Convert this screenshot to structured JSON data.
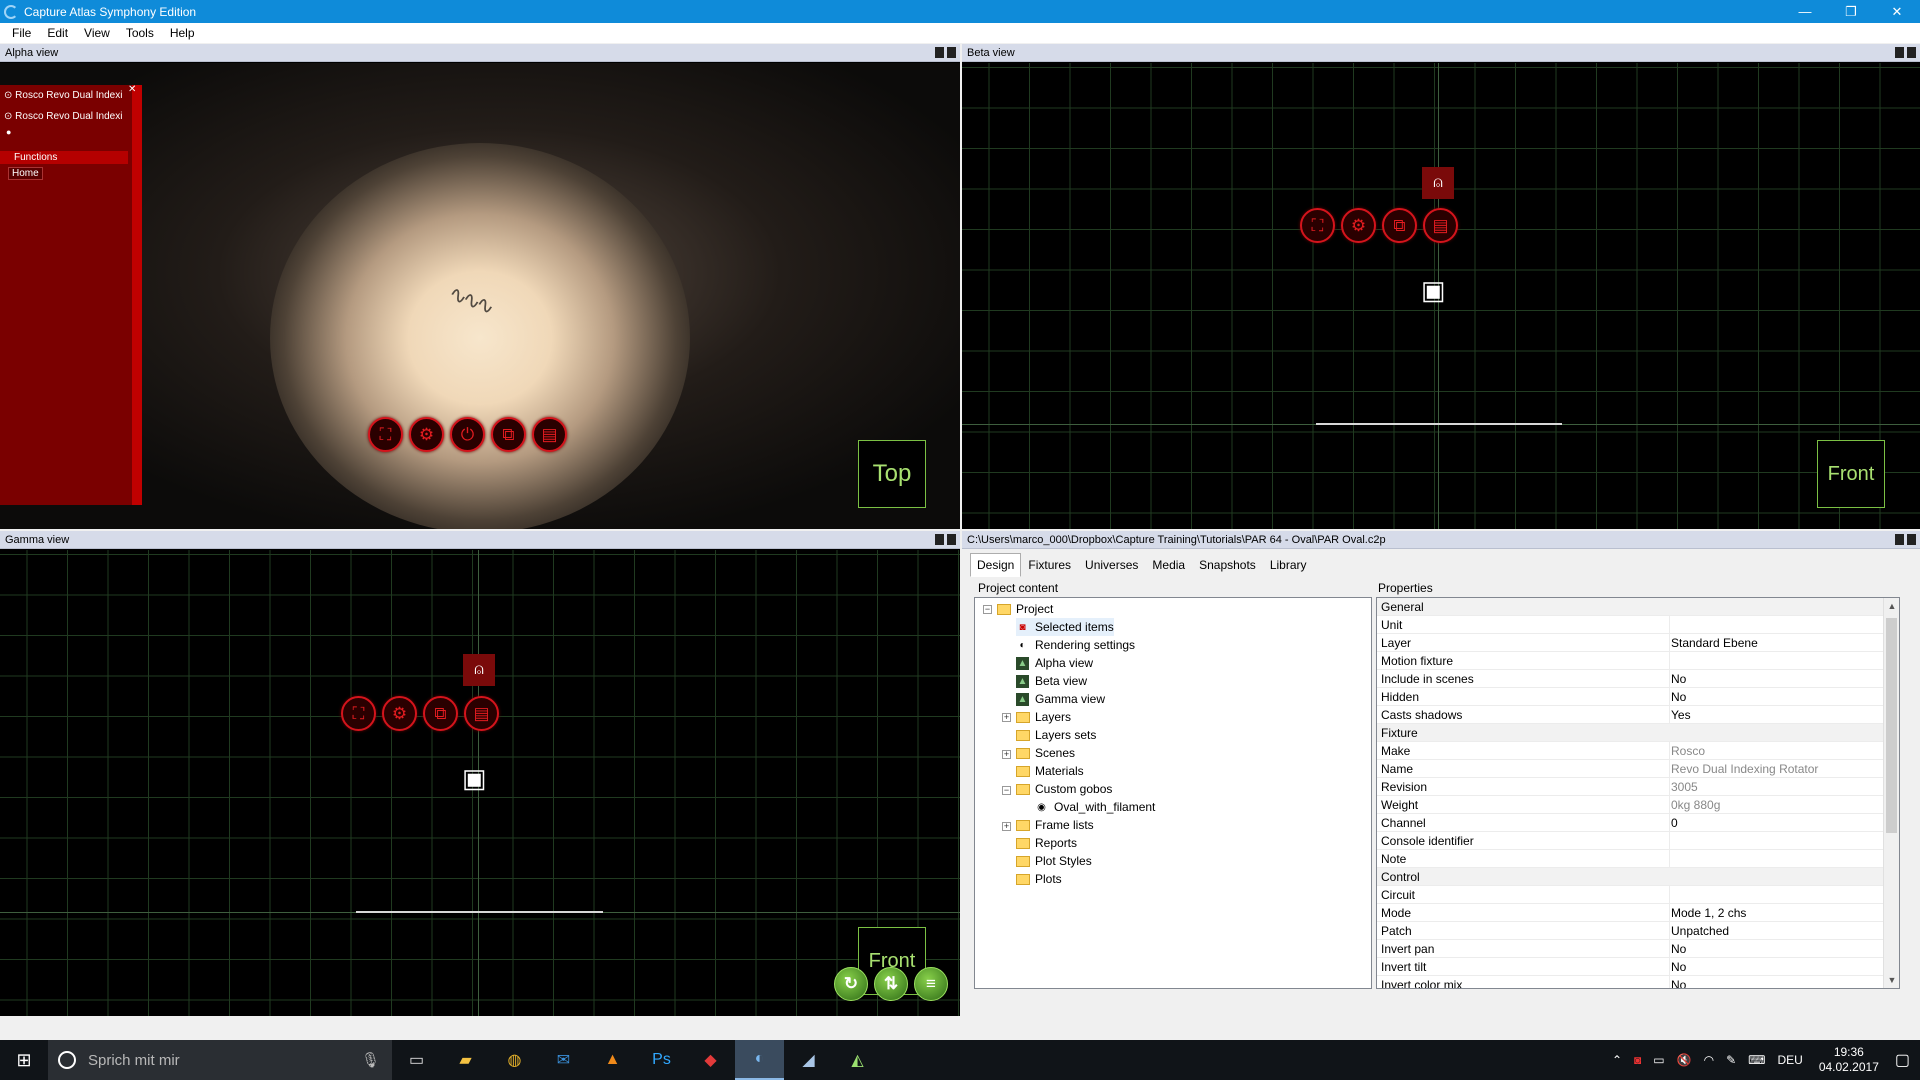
{
  "window": {
    "title": "Capture Atlas Symphony Edition",
    "minimize": "—",
    "restore": "❐",
    "close": "✕"
  },
  "menu": [
    "File",
    "Edit",
    "View",
    "Tools",
    "Help"
  ],
  "alpha": {
    "title": "Alpha view",
    "panel": {
      "fixture1": "Rosco Revo Dual Indexi",
      "fixture2": "Rosco Revo Dual Indexi",
      "functions": "Functions",
      "home": "Home"
    },
    "viewbox": "Top"
  },
  "beta": {
    "title": "Beta view",
    "viewbox": "Front"
  },
  "gamma": {
    "title": "Gamma view",
    "viewbox": "Front"
  },
  "project": {
    "path": "C:\\Users\\marco_000\\Dropbox\\Capture Training\\Tutorials\\PAR 64 - Oval\\PAR Oval.c2p",
    "tabs": [
      "Design",
      "Fixtures",
      "Universes",
      "Media",
      "Snapshots",
      "Library"
    ],
    "content_label": "Project content",
    "properties_label": "Properties",
    "tree": [
      {
        "label": "Project",
        "icon": "folder-icon"
      },
      {
        "label": "Selected items",
        "icon": "selected-items-icon"
      },
      {
        "label": "Rendering settings",
        "icon": "rendering-icon"
      },
      {
        "label": "Alpha view",
        "icon": "view-icon"
      },
      {
        "label": "Beta view",
        "icon": "view-icon"
      },
      {
        "label": "Gamma view",
        "icon": "view-icon"
      },
      {
        "label": "Layers",
        "icon": "folder-icon"
      },
      {
        "label": "Layers sets",
        "icon": "folder-icon"
      },
      {
        "label": "Scenes",
        "icon": "folder-icon"
      },
      {
        "label": "Materials",
        "icon": "folder-icon"
      },
      {
        "label": "Custom gobos",
        "icon": "folder-icon"
      },
      {
        "label": "Oval_with_filament",
        "icon": "gobo-icon"
      },
      {
        "label": "Frame lists",
        "icon": "folder-icon"
      },
      {
        "label": "Reports",
        "icon": "folder-icon"
      },
      {
        "label": "Plot Styles",
        "icon": "folder-icon"
      },
      {
        "label": "Plots",
        "icon": "folder-icon"
      }
    ],
    "props": [
      {
        "k": "General",
        "v": "",
        "cat": true
      },
      {
        "k": "Unit",
        "v": ""
      },
      {
        "k": "Layer",
        "v": "Standard Ebene"
      },
      {
        "k": "Motion fixture",
        "v": ""
      },
      {
        "k": "Include in scenes",
        "v": "No"
      },
      {
        "k": "Hidden",
        "v": "No"
      },
      {
        "k": "Casts shadows",
        "v": "Yes"
      },
      {
        "k": "Fixture",
        "v": "",
        "cat": true
      },
      {
        "k": "Make",
        "v": "Rosco",
        "gray": true
      },
      {
        "k": "Name",
        "v": "Revo Dual Indexing Rotator",
        "gray": true
      },
      {
        "k": "Revision",
        "v": "3005",
        "gray": true
      },
      {
        "k": "Weight",
        "v": "0kg 880g",
        "gray": true
      },
      {
        "k": "Channel",
        "v": "0"
      },
      {
        "k": "Console identifier",
        "v": ""
      },
      {
        "k": "Note",
        "v": ""
      },
      {
        "k": "Control",
        "v": "",
        "cat": true
      },
      {
        "k": "Circuit",
        "v": ""
      },
      {
        "k": "Mode",
        "v": "Mode 1, 2 chs"
      },
      {
        "k": "Patch",
        "v": "Unpatched"
      },
      {
        "k": "Invert pan",
        "v": "No"
      },
      {
        "k": "Invert tilt",
        "v": "No"
      },
      {
        "k": "Invert color mix",
        "v": "No"
      }
    ]
  },
  "taskbar": {
    "search_placeholder": "Sprich mit mir",
    "lang": "DEU",
    "time": "19:36",
    "date": "04.02.2017"
  }
}
